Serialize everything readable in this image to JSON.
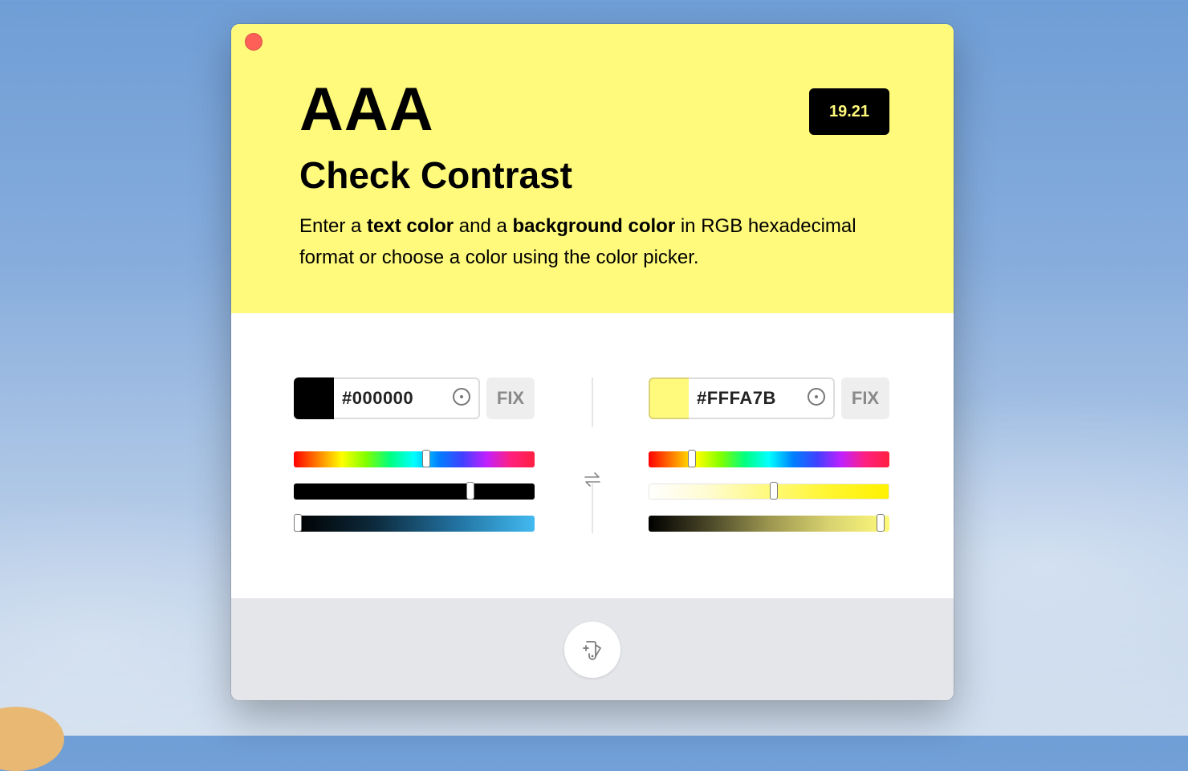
{
  "header": {
    "grade": "AAA",
    "ratio": "19.21",
    "title": "Check Contrast",
    "desc": {
      "p1": "Enter a ",
      "b1": "text color",
      "p2": " and a ",
      "b2": "background color",
      "p3": " in RGB hexadecimal format or choose a color using the color picker."
    }
  },
  "text_color": {
    "hex": "#000000",
    "swatch_color": "#000000",
    "fix_label": "FIX",
    "hue": 0.55,
    "saturation": 0.74,
    "lightness": 0.0
  },
  "background_color": {
    "hex": "#FFFA7B",
    "swatch_color": "#FFFA7B",
    "fix_label": "FIX",
    "hue": 0.17,
    "saturation": 0.52,
    "lightness": 0.98
  },
  "icons": {
    "close": "close-icon",
    "picker": "eyedropper-target-icon",
    "swap": "swap-arrows-icon",
    "palette": "color-palette-icon"
  },
  "colors": {
    "header_bg": "#FFFA7B",
    "ratio_badge_bg": "#000000",
    "ratio_badge_text": "#FFFA7B",
    "footer_bg": "#E4E6EA"
  }
}
